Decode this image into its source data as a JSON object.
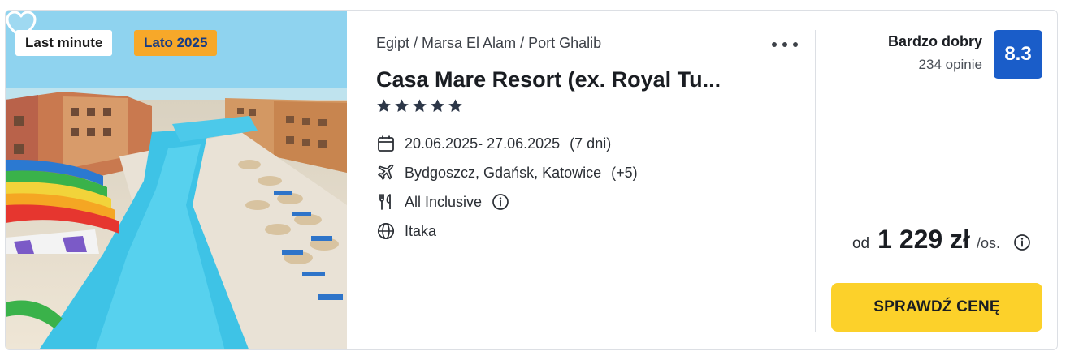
{
  "badges": {
    "last_minute": "Last minute",
    "season": "Lato 2025"
  },
  "offer": {
    "breadcrumb": "Egipt / Marsa El Alam / Port Ghalib",
    "title": "Casa Mare Resort (ex. Royal Tu...",
    "stars": 5,
    "dates": "20.06.2025- 27.06.2025",
    "duration": "(7 dni)",
    "departures": "Bydgoszcz, Gdańsk, Katowice",
    "departures_more": "(+5)",
    "board": "All Inclusive",
    "operator": "Itaka"
  },
  "rating": {
    "label": "Bardzo dobry",
    "count": "234 opinie",
    "score": "8.3"
  },
  "price": {
    "prefix": "od",
    "value": "1 229 zł",
    "per": "/os."
  },
  "cta": {
    "label": "SPRAWDŹ CENĘ"
  },
  "icons": {
    "favorite": "heart-icon",
    "menu": "more-dots-icon",
    "star": "star-icon",
    "dates": "calendar-icon",
    "departures": "plane-icon",
    "board": "cutlery-icon",
    "operator": "globe-icon",
    "info": "info-icon"
  },
  "colors": {
    "accent_yellow": "#fcd12a",
    "score_blue": "#1a5dc9",
    "season_badge": "#f7a829"
  }
}
